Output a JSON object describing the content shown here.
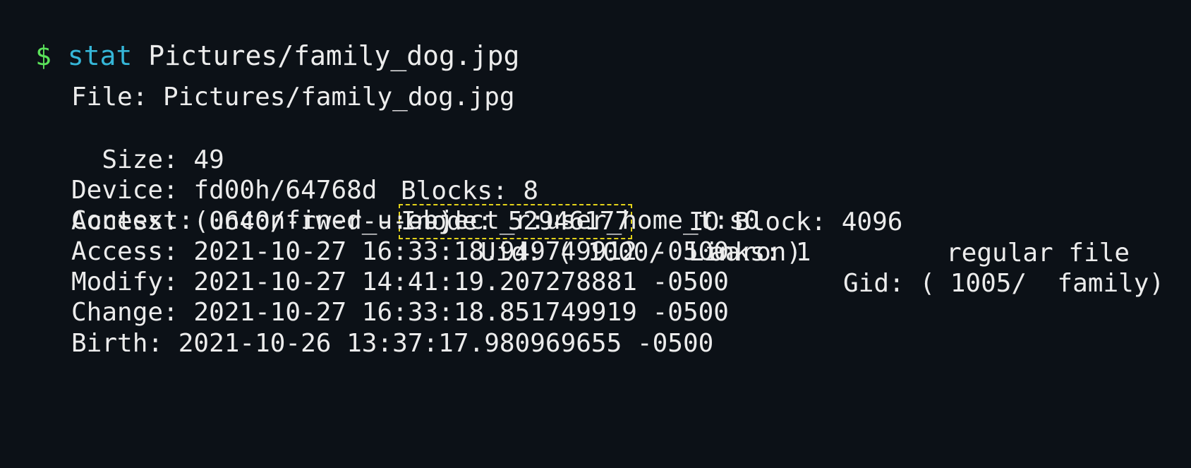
{
  "command": {
    "prompt": "$",
    "name": "stat",
    "argument": "Pictures/family_dog.jpg"
  },
  "output": {
    "file": "File: Pictures/family_dog.jpg",
    "size": "  Size: 49",
    "blocks": "Blocks: 8",
    "io_block": "IO Block: 4096",
    "file_type": "regular file",
    "device": "Device: fd00h/64768d",
    "inode": "Inode: 52946177",
    "links": "Links: 1",
    "access_perms": "Access: (0640/-rw-r-----)",
    "uid": "Uid: ( 1000/   aaron)",
    "gid": "Gid: ( 1005/  family)",
    "context": "Context: unconfined_u:object_r:user_home_t:s0",
    "access_time": "Access: 2021-10-27 16:33:18.949749912 -0500",
    "modify_time": "Modify: 2021-10-27 14:41:19.207278881 -0500",
    "change_time": "Change: 2021-10-27 16:33:18.851749919 -0500",
    "birth_time": "Birth: 2021-10-26 13:37:17.980969655 -0500"
  },
  "colors": {
    "background": "#0c1117",
    "prompt": "#5be35b",
    "command": "#35b6d8",
    "text": "#ececec",
    "highlight_box": "#e3d21a"
  }
}
